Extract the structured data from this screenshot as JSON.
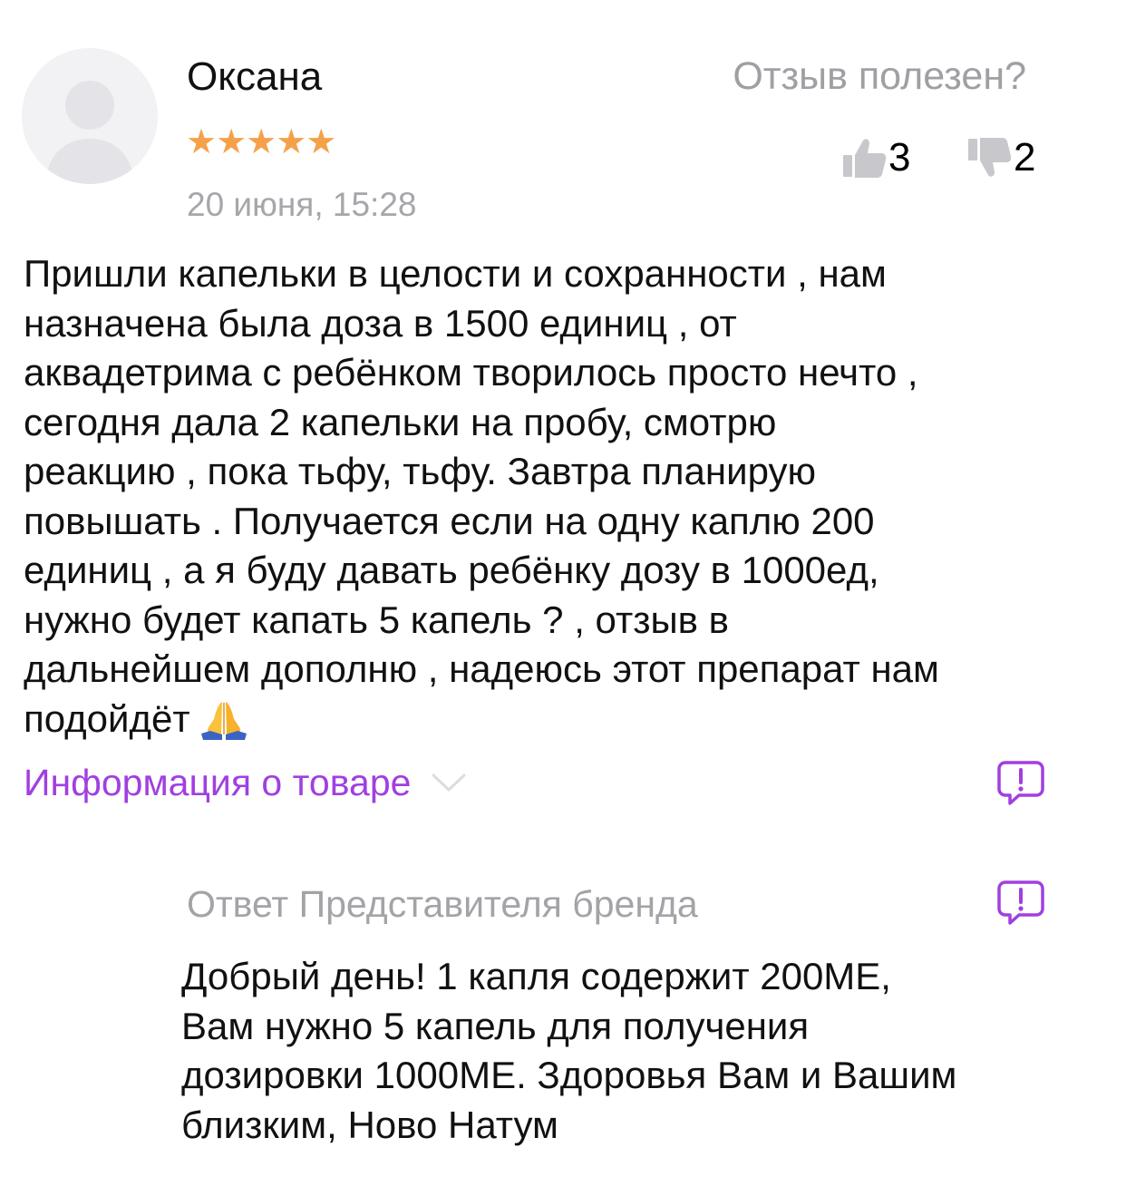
{
  "review": {
    "author": "Оксана",
    "stars": "★★★★★",
    "rating": 5,
    "date": "20 июня, 15:28",
    "helpful_question": "Отзыв полезен?",
    "likes": "3",
    "dislikes": "2",
    "text": "Пришли капельки в целости и сохранности , нам\nназначена была доза в 1500 единиц , от\nаквадетрима с ребёнком творилось просто нечто ,\nсегодня дала 2 капельки на пробу, смотрю\nреакцию , пока тьфу, тьфу. Завтра планирую\nповышать . Получается если на одну каплю 200\nединиц , а я буду давать ребёнку дозу в 1000ед,\nнужно будет капать 5 капель ? , отзыв в\nдальнейшем дополню , надеюсь этот препарат нам\nподойдёт",
    "emoji": "folded-hands",
    "product_info_label": "Информация о товаре"
  },
  "brand_reply": {
    "title": "Ответ Представителя бренда",
    "text": "Добрый день! 1 капля содержит 200МЕ,\nВам нужно 5 капель для получения\nдозировки 1000МЕ. Здоровья Вам и Вашим\nблизким, Ново Натум"
  },
  "icons": {
    "avatar": "user-placeholder-icon",
    "like": "thumbs-up-icon",
    "dislike": "thumbs-down-icon",
    "expand": "chevron-down-icon",
    "report": "report-bubble-icon"
  },
  "colors": {
    "accent": "#a13fe0",
    "star": "#f5a14a",
    "muted_text": "#a6a6ab",
    "thumb": "#c7c7cc"
  }
}
